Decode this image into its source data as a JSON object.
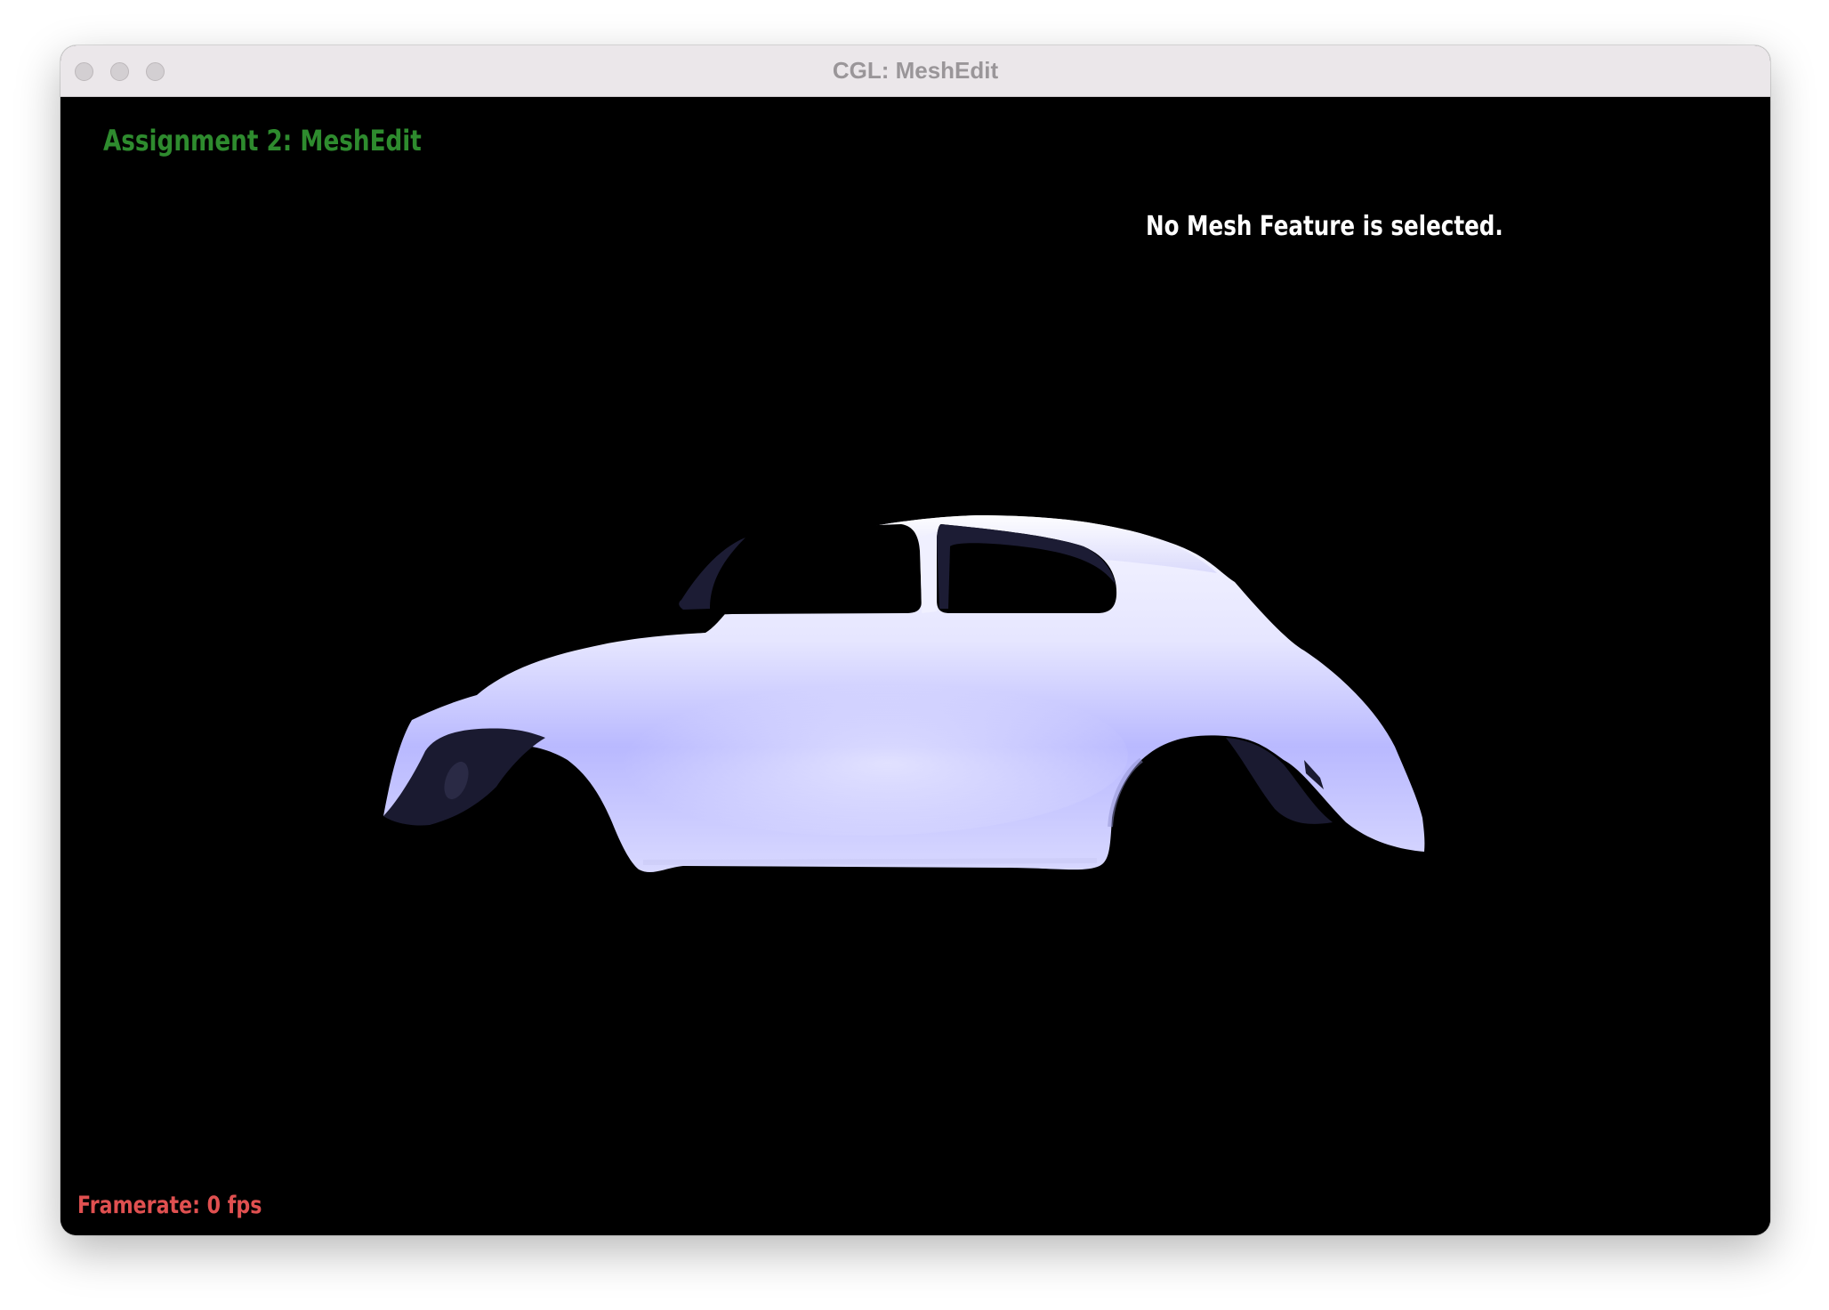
{
  "window": {
    "title": "CGL: MeshEdit"
  },
  "viewport": {
    "assignment_title": "Assignment 2: MeshEdit",
    "selection_status": "No Mesh Feature is selected.",
    "framerate": "Framerate: 0 fps",
    "background_color": "#000000",
    "mesh_color": "#b8b8ff"
  },
  "colors": {
    "title_green": "#2e8b2e",
    "status_white": "#ffffff",
    "framerate_red": "#e05050"
  }
}
